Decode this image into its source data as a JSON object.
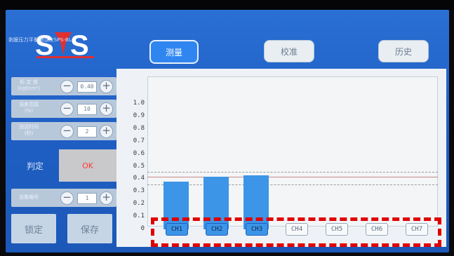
{
  "logo": {
    "mark": "SPS",
    "subtitle": "剥膜压力平衡测试仪SPS-BL"
  },
  "tabs": [
    {
      "label": "测量",
      "active": true
    },
    {
      "label": "校准",
      "active": false
    },
    {
      "label": "历史",
      "active": false
    }
  ],
  "settings": {
    "calibration": {
      "label_line1": "标 定 值",
      "label_line2": "(kgf/cm²)",
      "value": "0.40",
      "minus": "−",
      "plus": "+"
    },
    "error_range": {
      "label_line1": "误差范围",
      "label_line2": "(%)",
      "value": "10",
      "minus": "−",
      "plus": "+"
    },
    "test_time": {
      "label_line1": "测试时间",
      "label_line2": "(秒)",
      "value": "2",
      "minus": "−",
      "plus": "+"
    },
    "device_no": {
      "label": "设备编号",
      "value": "1",
      "minus": "−",
      "plus": "+"
    }
  },
  "judge": {
    "label": "判定",
    "result": "OK",
    "result_color": "#ff3b30"
  },
  "buttons": {
    "lock": "锁定",
    "save": "保存"
  },
  "chart_data": {
    "type": "bar",
    "categories": [
      "CH1",
      "CH2",
      "CH3",
      "CH4",
      "CH5",
      "CH6",
      "CH7"
    ],
    "values": [
      0.38,
      0.42,
      0.43,
      0,
      0,
      0,
      0
    ],
    "active_channels": [
      true,
      true,
      true,
      false,
      false,
      false,
      false
    ],
    "ylim": [
      0,
      1.0
    ],
    "yticks": [
      "1.0",
      "0.9",
      "0.8",
      "0.7",
      "0.6",
      "0.5",
      "0.4",
      "0.3",
      "0.2",
      "0.1",
      "0"
    ],
    "reference_lines": [
      {
        "value": 0.46,
        "style": "dashed",
        "color": "#9a9a9a"
      },
      {
        "value": 0.42,
        "style": "solid",
        "color": "#c98a8a"
      },
      {
        "value": 0.36,
        "style": "dashed",
        "color": "#9a9a9a"
      }
    ],
    "bar_color": "#3c95e6"
  }
}
